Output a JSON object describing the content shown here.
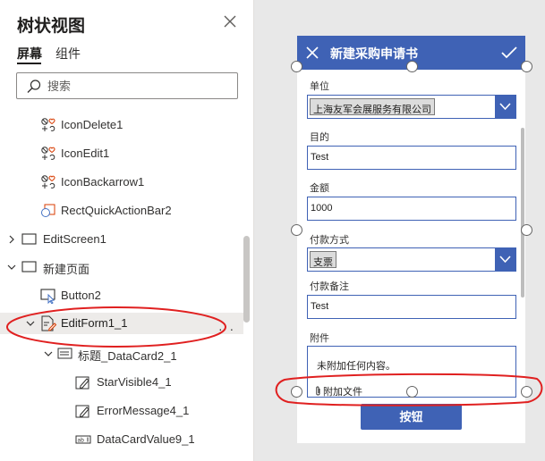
{
  "tree_panel": {
    "title": "树状视图",
    "tabs": [
      {
        "label": "屏幕",
        "active": true
      },
      {
        "label": "组件",
        "active": false
      }
    ],
    "search": {
      "placeholder": "搜索"
    },
    "items": [
      {
        "label": "IconDelete1",
        "icon": "icon-control-icon"
      },
      {
        "label": "IconEdit1",
        "icon": "icon-control-icon"
      },
      {
        "label": "IconBackarrow1",
        "icon": "icon-control-icon"
      },
      {
        "label": "RectQuickActionBar2",
        "icon": "rectangle-shape-icon"
      },
      {
        "label": "EditScreen1",
        "icon": "screen-icon",
        "expanded": false
      },
      {
        "label": "新建页面",
        "icon": "screen-icon",
        "expanded": true
      },
      {
        "label": "Button2",
        "icon": "button-icon"
      },
      {
        "label": "EditForm1_1",
        "icon": "edit-form-icon",
        "expanded": true,
        "selected": true
      },
      {
        "label": "标题_DataCard2_1",
        "icon": "data-card-icon",
        "expanded": true
      },
      {
        "label": "StarVisible4_1",
        "icon": "label-icon"
      },
      {
        "label": "ErrorMessage4_1",
        "icon": "label-icon"
      },
      {
        "label": "DataCardValue9_1",
        "icon": "text-input-icon"
      }
    ]
  },
  "form": {
    "title": "新建采购申请书",
    "fields": {
      "unit": {
        "label": "单位",
        "value": "上海友军会展服务有限公司"
      },
      "purpose": {
        "label": "目的",
        "value": "Test"
      },
      "amount": {
        "label": "金额",
        "value": "1000"
      },
      "payment_method": {
        "label": "付款方式",
        "value": "支票"
      },
      "payment_note": {
        "label": "付款备注",
        "value": "Test"
      },
      "attachment": {
        "label": "附件",
        "empty_text": "未附加任何内容。",
        "attach_link": "附加文件"
      }
    },
    "submit_label": "按钮"
  },
  "colors": {
    "accent": "#3f62b5",
    "annotation": "#e02020",
    "canvas_bg": "#e8e8e8"
  }
}
